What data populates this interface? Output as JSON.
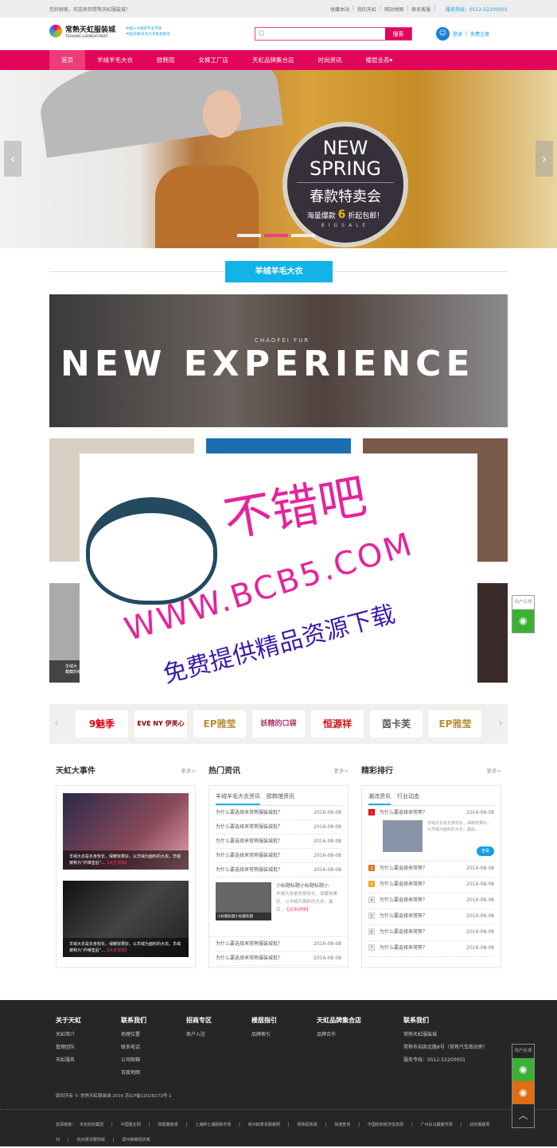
{
  "topbar": {
    "welcome": "您好顾客，欢迎来到常熟天虹服装城！",
    "links": [
      "收藏本站",
      "我的天虹",
      "网站地图",
      "联系客服"
    ],
    "hotline": "服务热线：0512-52200001"
  },
  "header": {
    "logo_cn": "常熟天虹服装城",
    "logo_en": "TEXHONG GARMENT-MART",
    "slogan1": "中国十大服装专业市场",
    "slogan2": "中国羊绒/羊毛大衣批发基地",
    "search_placeholder": "",
    "search_button": "搜索",
    "login": "登录",
    "register": "免费注册"
  },
  "nav": [
    "首页",
    "羊绒羊毛大衣",
    "欧韩馆",
    "女裤工厂店",
    "天虹品牌集合店",
    "时尚资讯",
    "楼层业态▾"
  ],
  "hero": {
    "line1": "NEW",
    "line2": "SPRING",
    "line3": "春款特卖会",
    "line4a": "海量爆款",
    "line4b": "6",
    "line4c": "折起包邮！",
    "line5": "BIGSALE",
    "prev": "‹",
    "next": "›"
  },
  "section": {
    "title": "羊绒羊毛大衣",
    "banner_text": "NEW EXPERIENCE",
    "banner_sub": "CHAOFEI FUR"
  },
  "tiles": {
    "caption1": "羊绒大",
    "caption2": "藏藏的细节"
  },
  "watermark": {
    "brand": "不错吧",
    "url": "WWW.BCB5.COM",
    "slogan": "免费提供精品资源下载"
  },
  "brands": [
    "9魅季",
    "EVE NY 伊芙心悦",
    "EP雅莹",
    "妖精的口袋",
    "恒源祥",
    "茵卡芙",
    "EP雅莹"
  ],
  "events": {
    "title": "天虹大事件",
    "more": "更多>",
    "items": [
      {
        "text": "羊绒大衣是衣身较长，保暖效果好，以羊绒为面料的大衣。羊绒被称为“纤维皇后”...",
        "link": "【点击详情】"
      },
      {
        "text": "羊绒大衣是衣身较长，保暖效果好，以羊绒为面料的大衣。羊绒被称为“纤维皇后”...",
        "link": "【点击详情】"
      }
    ]
  },
  "news": {
    "title": "热门资讯",
    "more": "更多>",
    "tabs": [
      "羊绒羊毛大衣资讯",
      "欧韩馆资讯"
    ],
    "rows": [
      {
        "t": "为什么要选择来常熟服装城批？",
        "d": "2016-08-08"
      },
      {
        "t": "为什么要选择来常熟服装城批？",
        "d": "2016-08-08"
      },
      {
        "t": "为什么要选择来常熟服装城批？",
        "d": "2016-08-08"
      },
      {
        "t": "为什么要选择来常熟服装城批？",
        "d": "2016-08-08"
      },
      {
        "t": "为什么要选择来常熟服装城批？",
        "d": "2016-08-08"
      }
    ],
    "feature": {
      "title": "小标题标题小标题标题小",
      "text": "羊绒大衣是衣身较长，保暖效果好，以羊绒为面料的大衣。最后...",
      "link": "【点击详情】",
      "caption": "小标题标题小标题标题"
    },
    "rows2": [
      {
        "t": "为什么要选择来常熟服装城批？",
        "d": "2016-08-08"
      },
      {
        "t": "为什么要选择来常熟服装城批？",
        "d": "2016-08-08"
      }
    ]
  },
  "ranking": {
    "title": "精彩排行",
    "more": "更多>",
    "tabs": [
      "潮流资讯",
      "行业动态"
    ],
    "first": {
      "n": "1",
      "t": "为什么要选择来常熟？",
      "d": "2016-08-08",
      "text": "羊绒大衣是衣身较长，保暖效果好，以羊绒为面料的大衣。最后...",
      "button": "查看"
    },
    "rows": [
      {
        "n": "2",
        "t": "为什么要选择来常熟？",
        "d": "2016-08-08"
      },
      {
        "n": "3",
        "t": "为什么要选择来常熟？",
        "d": "2016-08-08"
      },
      {
        "n": "4",
        "t": "为什么要选择来常熟？",
        "d": "2016-08-08"
      },
      {
        "n": "5",
        "t": "为什么要选择来常熟？",
        "d": "2016-08-08"
      },
      {
        "n": "6",
        "t": "为什么要选择来常熟？",
        "d": "2016-08-08"
      },
      {
        "n": "7",
        "t": "为什么要选择来常熟？",
        "d": "2016-08-08"
      }
    ],
    "colors": {
      "1": "#e60012",
      "2": "#e0781e",
      "3": "#f5a623"
    }
  },
  "footer": {
    "cols": [
      {
        "title": "关于天虹",
        "items": [
          "天虹简介",
          "管理团队",
          "天虹服务"
        ]
      },
      {
        "title": "联系我们",
        "items": [
          "地理位置",
          "联系电话",
          "公司邮箱",
          "百度地图"
        ]
      },
      {
        "title": "招商专区",
        "items": [
          "商户入驻"
        ]
      },
      {
        "title": "楼层指引",
        "items": [
          "品牌索引"
        ]
      },
      {
        "title": "天虹品牌集合店",
        "items": [
          "品牌合作"
        ]
      },
      {
        "title": "联系我们",
        "items": [
          "常熟天虹服装城",
          "常熟市招商北路8号（常熟汽车南站旁）",
          "服务专线：0512-52200001"
        ]
      }
    ],
    "copyright": "版权所有 © 常熟天虹服装城 2016 苏ICP备12028273号-1",
    "friends_label": "友情链接：",
    "friends": [
      "天虹纺织集团",
      "中国建业网",
      "四季服装城",
      "上海新七浦服装市场",
      "杭州四季青服装网",
      "常熟招商城",
      "快递查询",
      "中国纺织经济信息网",
      "广州白马服装市场",
      "纺织服装周刊",
      "杭州意法服饰城",
      "郑州锦荣轻纺城"
    ]
  },
  "side": {
    "feedback": "用户反馈",
    "wechat": "wechat-icon",
    "weibo": "weibo-icon",
    "top": "︿"
  }
}
